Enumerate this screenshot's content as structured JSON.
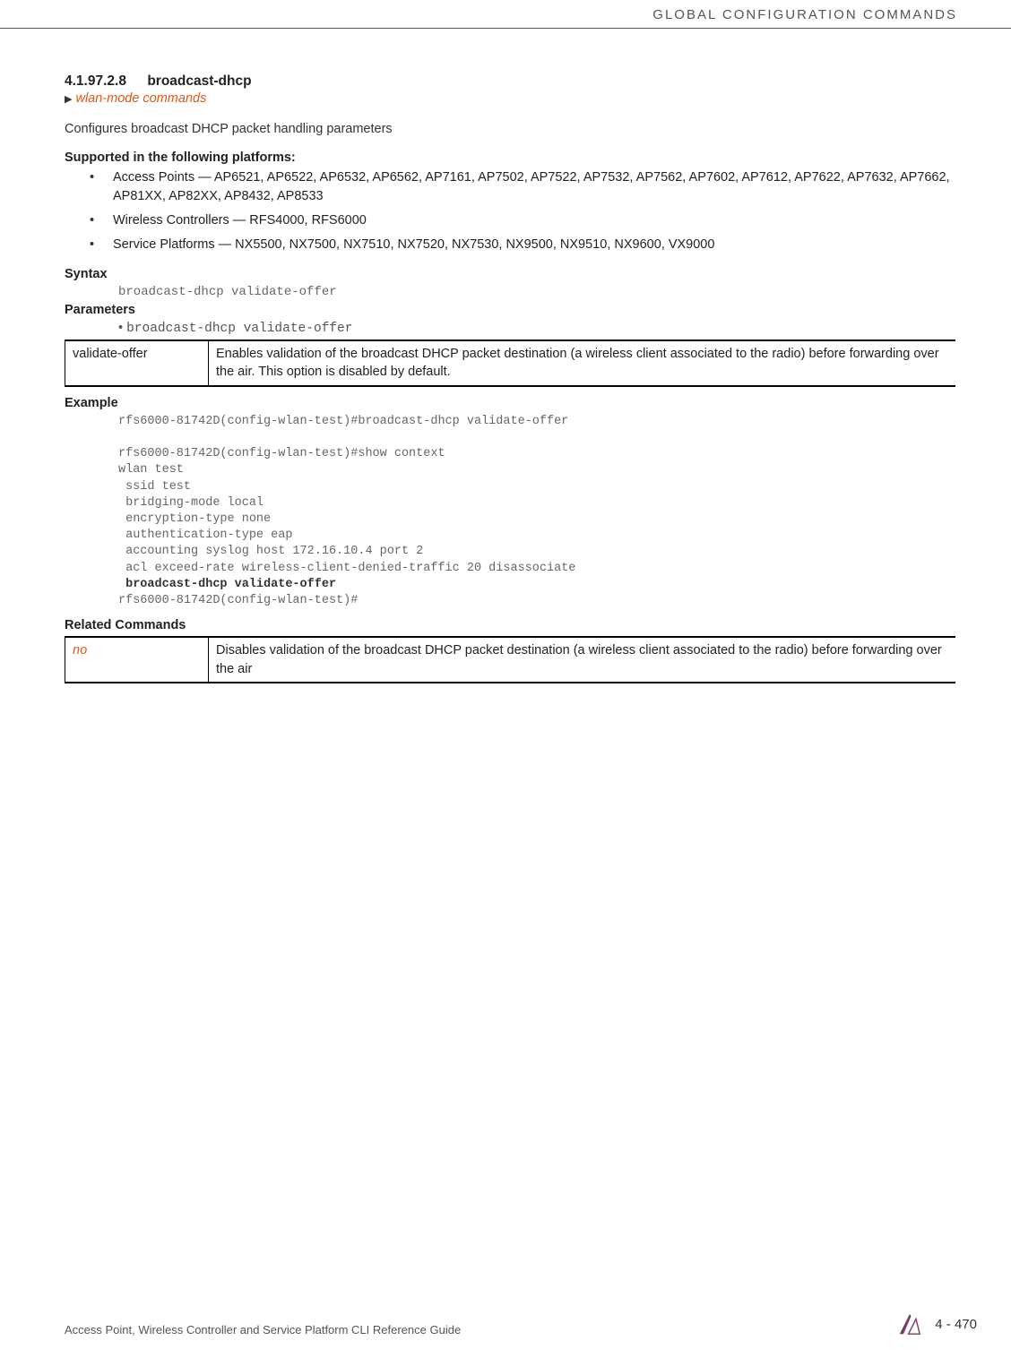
{
  "header": {
    "title": "GLOBAL CONFIGURATION COMMANDS"
  },
  "section": {
    "number": "4.1.97.2.8",
    "title": "broadcast-dhcp",
    "breadcrumb": "wlan-mode commands",
    "intro": "Configures broadcast DHCP packet handling parameters"
  },
  "supported": {
    "heading": "Supported in the following platforms:",
    "items": [
      "Access Points — AP6521, AP6522, AP6532, AP6562, AP7161, AP7502, AP7522, AP7532, AP7562, AP7602, AP7612, AP7622, AP7632, AP7662, AP81XX, AP82XX, AP8432, AP8533",
      "Wireless Controllers — RFS4000, RFS6000",
      "Service Platforms — NX5500, NX7500, NX7510, NX7520, NX7530, NX9500, NX9510, NX9600, VX9000"
    ]
  },
  "syntax": {
    "heading": "Syntax",
    "code": "broadcast-dhcp validate-offer"
  },
  "parameters": {
    "heading": "Parameters",
    "bullet": "broadcast-dhcp validate-offer",
    "table": {
      "col1": "validate-offer",
      "col2": "Enables validation of the broadcast DHCP packet destination (a wireless client associated to the radio) before forwarding over the air. This option is disabled by default."
    }
  },
  "example": {
    "heading": "Example",
    "lines_pre": "rfs6000-81742D(config-wlan-test)#broadcast-dhcp validate-offer\n\nrfs6000-81742D(config-wlan-test)#show context\nwlan test\n ssid test\n bridging-mode local\n encryption-type none\n authentication-type eap\n accounting syslog host 172.16.10.4 port 2\n acl exceed-rate wireless-client-denied-traffic 20 disassociate",
    "line_bold": " broadcast-dhcp validate-offer",
    "lines_post": "rfs6000-81742D(config-wlan-test)#"
  },
  "related": {
    "heading": "Related Commands",
    "table": {
      "col1": "no",
      "col2": "Disables validation of the broadcast DHCP packet destination (a wireless client associated to the radio) before forwarding over the air"
    }
  },
  "footer": {
    "left": "Access Point, Wireless Controller and Service Platform CLI Reference Guide",
    "page": "4 - 470"
  }
}
